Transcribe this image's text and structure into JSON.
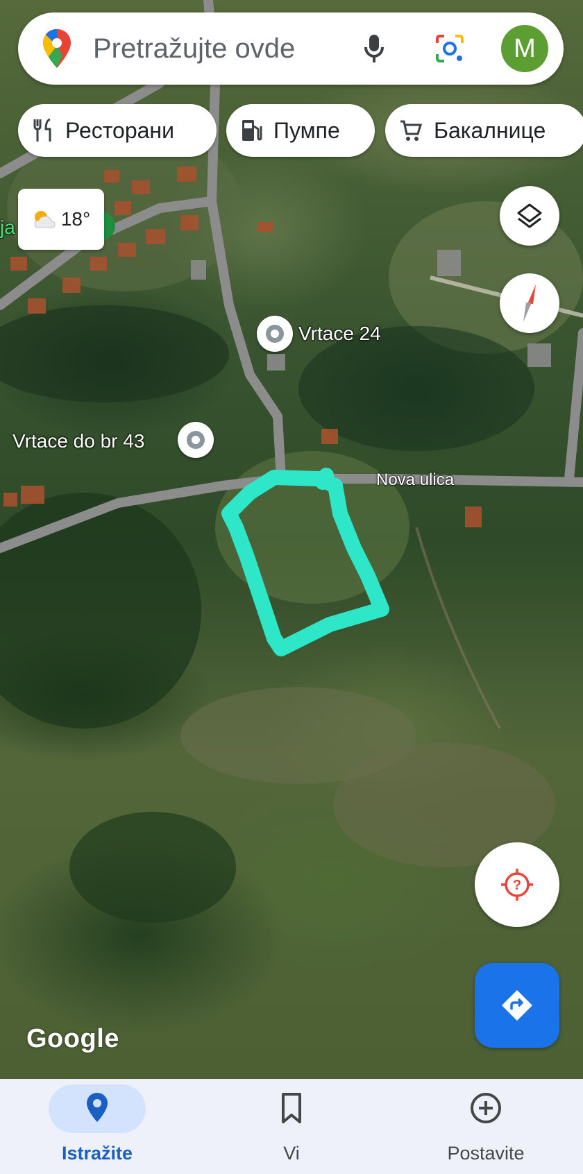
{
  "search": {
    "placeholder": "Pretražujte ovde",
    "avatar_letter": "M"
  },
  "chips": [
    {
      "label": "Ресторани",
      "icon": "restaurant-icon"
    },
    {
      "label": "Пумпе",
      "icon": "gas-station-icon"
    },
    {
      "label": "Бакалнице",
      "icon": "shopping-cart-icon"
    }
  ],
  "weather": {
    "temperature": "18°",
    "icon": "partly-cloudy-icon"
  },
  "map": {
    "places": [
      {
        "name": "Vrtace 24"
      },
      {
        "name": "Vrtace do br 43"
      }
    ],
    "street": "Nova ulica",
    "attribution": "Google",
    "edge_fragment": "ja",
    "drawing_color": "#2ee6c8"
  },
  "nav": [
    {
      "label": "Istražite",
      "icon": "explore-pin-icon",
      "active": true
    },
    {
      "label": "Vi",
      "icon": "bookmark-icon",
      "active": false
    },
    {
      "label": "Postavite",
      "icon": "add-circle-icon",
      "active": false
    }
  ],
  "colors": {
    "accent": "#1a73e8",
    "avatar": "#5d9e33",
    "nav_bg": "#eef1f9",
    "location_icon": "#ea4335"
  }
}
